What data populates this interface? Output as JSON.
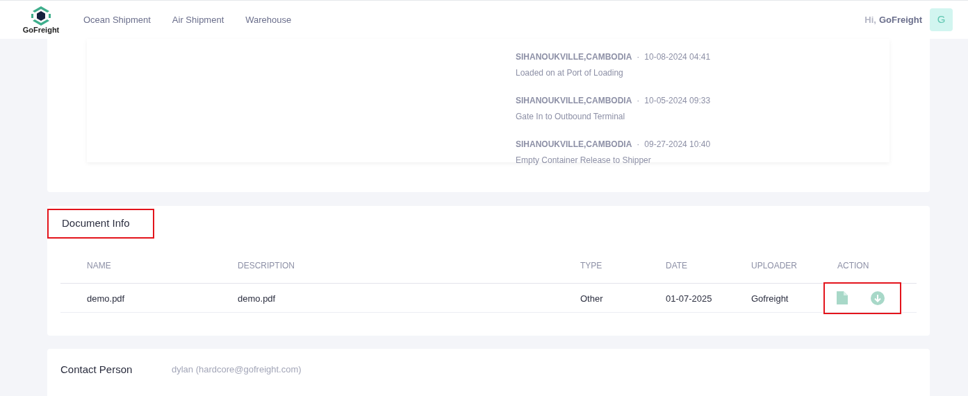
{
  "header": {
    "logo_text": "GoFreight",
    "nav": [
      "Ocean Shipment",
      "Air Shipment",
      "Warehouse"
    ],
    "greeting": "Hi,",
    "user_name": "GoFreight",
    "avatar": "G"
  },
  "events": [
    {
      "location": "SIHANOUKVILLE,CAMBODIA",
      "separator": "·",
      "time": "10-08-2024 04:41",
      "description": "Loaded on at Port of Loading"
    },
    {
      "location": "SIHANOUKVILLE,CAMBODIA",
      "separator": "·",
      "time": "10-05-2024 09:33",
      "description": "Gate In to Outbound Terminal"
    },
    {
      "location": "SIHANOUKVILLE,CAMBODIA",
      "separator": "·",
      "time": "09-27-2024 10:40",
      "description": "Empty Container Release to Shipper"
    }
  ],
  "document_info": {
    "title": "Document Info",
    "highlighted": true,
    "columns": [
      "NAME",
      "DESCRIPTION",
      "TYPE",
      "DATE",
      "UPLOADER",
      "ACTION"
    ],
    "rows": [
      {
        "cells": [
          "demo.pdf",
          "demo.pdf",
          "Other",
          "01-07-2025",
          "Gofreight"
        ],
        "actions_highlighted": true
      }
    ]
  },
  "contact": {
    "title": "Contact Person",
    "value": "dylan (hardcore@gofreight.com)"
  }
}
